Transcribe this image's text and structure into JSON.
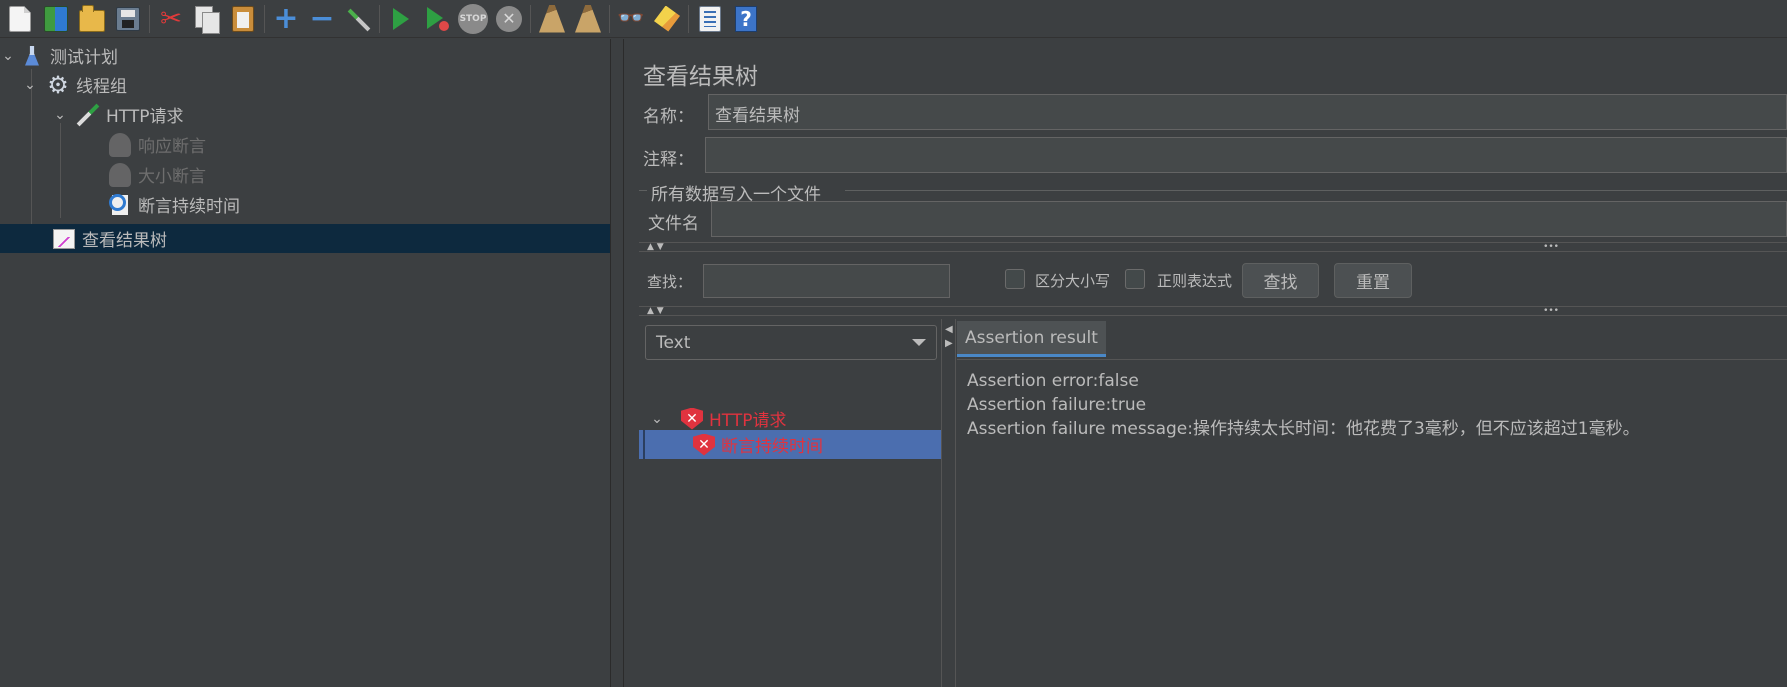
{
  "toolbar": {
    "buttons": [
      "new-icon",
      "templates-icon",
      "open-icon",
      "save-icon",
      "cut-icon",
      "copy-icon",
      "paste-icon",
      "expand-icon",
      "collapse-icon",
      "toggle-icon",
      "start-icon",
      "start-no-pauses-icon",
      "stop-icon",
      "shutdown-icon",
      "clear-icon",
      "clear-all-icon",
      "search-icon",
      "reset-search-icon",
      "function-helper-icon",
      "help-icon"
    ],
    "stop_glyph": "STOP",
    "help_glyph": "?"
  },
  "left_tree": {
    "items": [
      {
        "label": "测试计划",
        "icon": "test-plan-icon",
        "expanded": true
      },
      {
        "label": "线程组",
        "icon": "thread-group-icon",
        "expanded": true
      },
      {
        "label": "HTTP请求",
        "icon": "http-sampler-icon",
        "expanded": true
      },
      {
        "label": "响应断言",
        "icon": "response-assertion-icon",
        "disabled": true
      },
      {
        "label": "大小断言",
        "icon": "size-assertion-icon",
        "disabled": true
      },
      {
        "label": "断言持续时间",
        "icon": "duration-assertion-icon"
      },
      {
        "label": "查看结果树",
        "icon": "view-results-tree-icon",
        "selected": true
      }
    ]
  },
  "panel": {
    "title": "查看结果树",
    "name_label": "名称：",
    "name_value": "查看结果树",
    "comment_label": "注释：",
    "comment_value": "",
    "file_group_label": "所有数据写入一个文件",
    "filename_label": "文件名",
    "filename_value": "",
    "search_label": "查找：",
    "search_value": "",
    "case_sensitive_label": "区分大小写",
    "regex_label": "正则表达式",
    "find_button": "查找",
    "reset_button": "重置"
  },
  "results": {
    "renderer_selected": "Text",
    "tree": [
      {
        "label": "HTTP请求",
        "status": "error"
      },
      {
        "label": "断言持续时间",
        "status": "error",
        "selected": true
      }
    ],
    "tab_label": "Assertion result",
    "lines": [
      "Assertion error:false",
      "Assertion failure:true",
      "Assertion failure message:操作持续太长时间：他花费了3毫秒，但不应该超过1毫秒。"
    ]
  },
  "colors": {
    "background": "#3c3f41",
    "selection": "#0d293e",
    "result_selection": "#4b6eaf",
    "error": "#e0333f",
    "tab_accent": "#4a88c7"
  }
}
